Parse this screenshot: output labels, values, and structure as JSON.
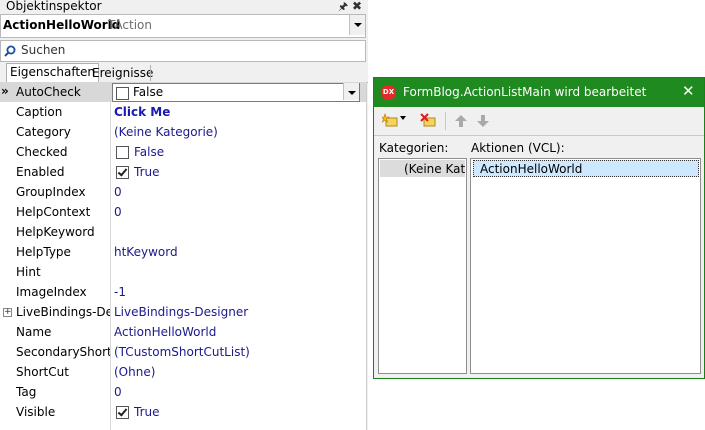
{
  "inspector": {
    "title": "Objektinspektor",
    "selected_object": {
      "name": "ActionHelloWorld",
      "type": "TAction"
    },
    "search_label": "Suchen",
    "tabs": [
      {
        "label": "Eigenschaften"
      },
      {
        "label": "Ereignisse"
      }
    ],
    "properties": [
      {
        "name": "AutoCheck",
        "value": "False"
      },
      {
        "name": "Caption",
        "value": "Click Me"
      },
      {
        "name": "Category",
        "value": "(Keine Kategorie)"
      },
      {
        "name": "Checked",
        "value": "False"
      },
      {
        "name": "Enabled",
        "value": "True"
      },
      {
        "name": "GroupIndex",
        "value": "0"
      },
      {
        "name": "HelpContext",
        "value": "0"
      },
      {
        "name": "HelpKeyword",
        "value": ""
      },
      {
        "name": "HelpType",
        "value": "htKeyword"
      },
      {
        "name": "Hint",
        "value": ""
      },
      {
        "name": "ImageIndex",
        "value": "-1"
      },
      {
        "name": "LiveBindings-Designer",
        "value": "LiveBindings-Designer"
      },
      {
        "name": "Name",
        "value": "ActionHelloWorld"
      },
      {
        "name": "SecondaryShortCuts",
        "value": "(TCustomShortCutList)"
      },
      {
        "name": "ShortCut",
        "value": "(Ohne)"
      },
      {
        "name": "Tag",
        "value": "0"
      },
      {
        "name": "Visible",
        "value": "True"
      }
    ],
    "row_marker": "»",
    "expand_symbol": "+"
  },
  "editor": {
    "title": "FormBlog.ActionListMain wird bearbeitet",
    "logo": "DX",
    "categories_label": "Kategorien:",
    "actions_label": "Aktionen (VCL):",
    "categories": [
      "(Keine Kategorie)"
    ],
    "actions": [
      "ActionHelloWorld"
    ],
    "accent_color": "#1f8a1f",
    "toolbar_icons": [
      "new-action-icon",
      "dropdown-arrow-icon",
      "delete-action-icon",
      "move-up-icon",
      "move-down-icon"
    ]
  }
}
